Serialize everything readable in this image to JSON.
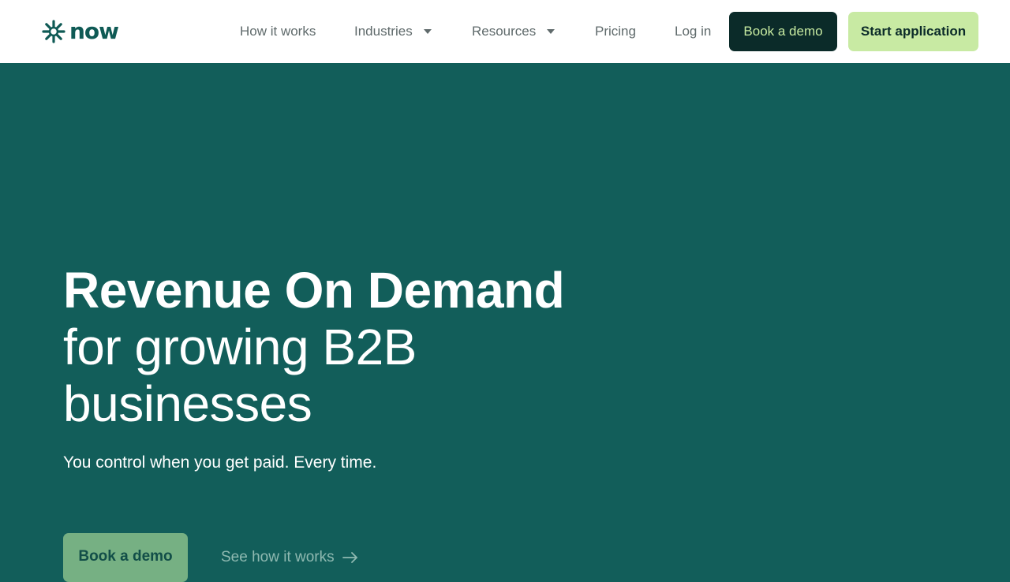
{
  "brand": {
    "logo_text": "now",
    "logo_icon": "asterisk-flower-icon",
    "primary_color": "#125e5a",
    "dark_color": "#0b2b29",
    "accent_color": "#c8eaa3"
  },
  "nav": {
    "items": [
      {
        "label": "How it works",
        "dropdown": false
      },
      {
        "label": "Industries",
        "dropdown": true
      },
      {
        "label": "Resources",
        "dropdown": true
      },
      {
        "label": "Pricing",
        "dropdown": false
      },
      {
        "label": "Log in",
        "dropdown": false
      }
    ],
    "book_demo_label": "Book a demo",
    "start_application_label": "Start application"
  },
  "hero": {
    "title_strong": "Revenue On Demand",
    "title_rest_1": "for growing B2B",
    "title_rest_2": "businesses",
    "subtitle": "You control when you get paid. Every time.",
    "primary_cta_label": "Book a demo",
    "secondary_cta_label": "See how it works",
    "secondary_cta_icon": "arrow-right-icon"
  }
}
